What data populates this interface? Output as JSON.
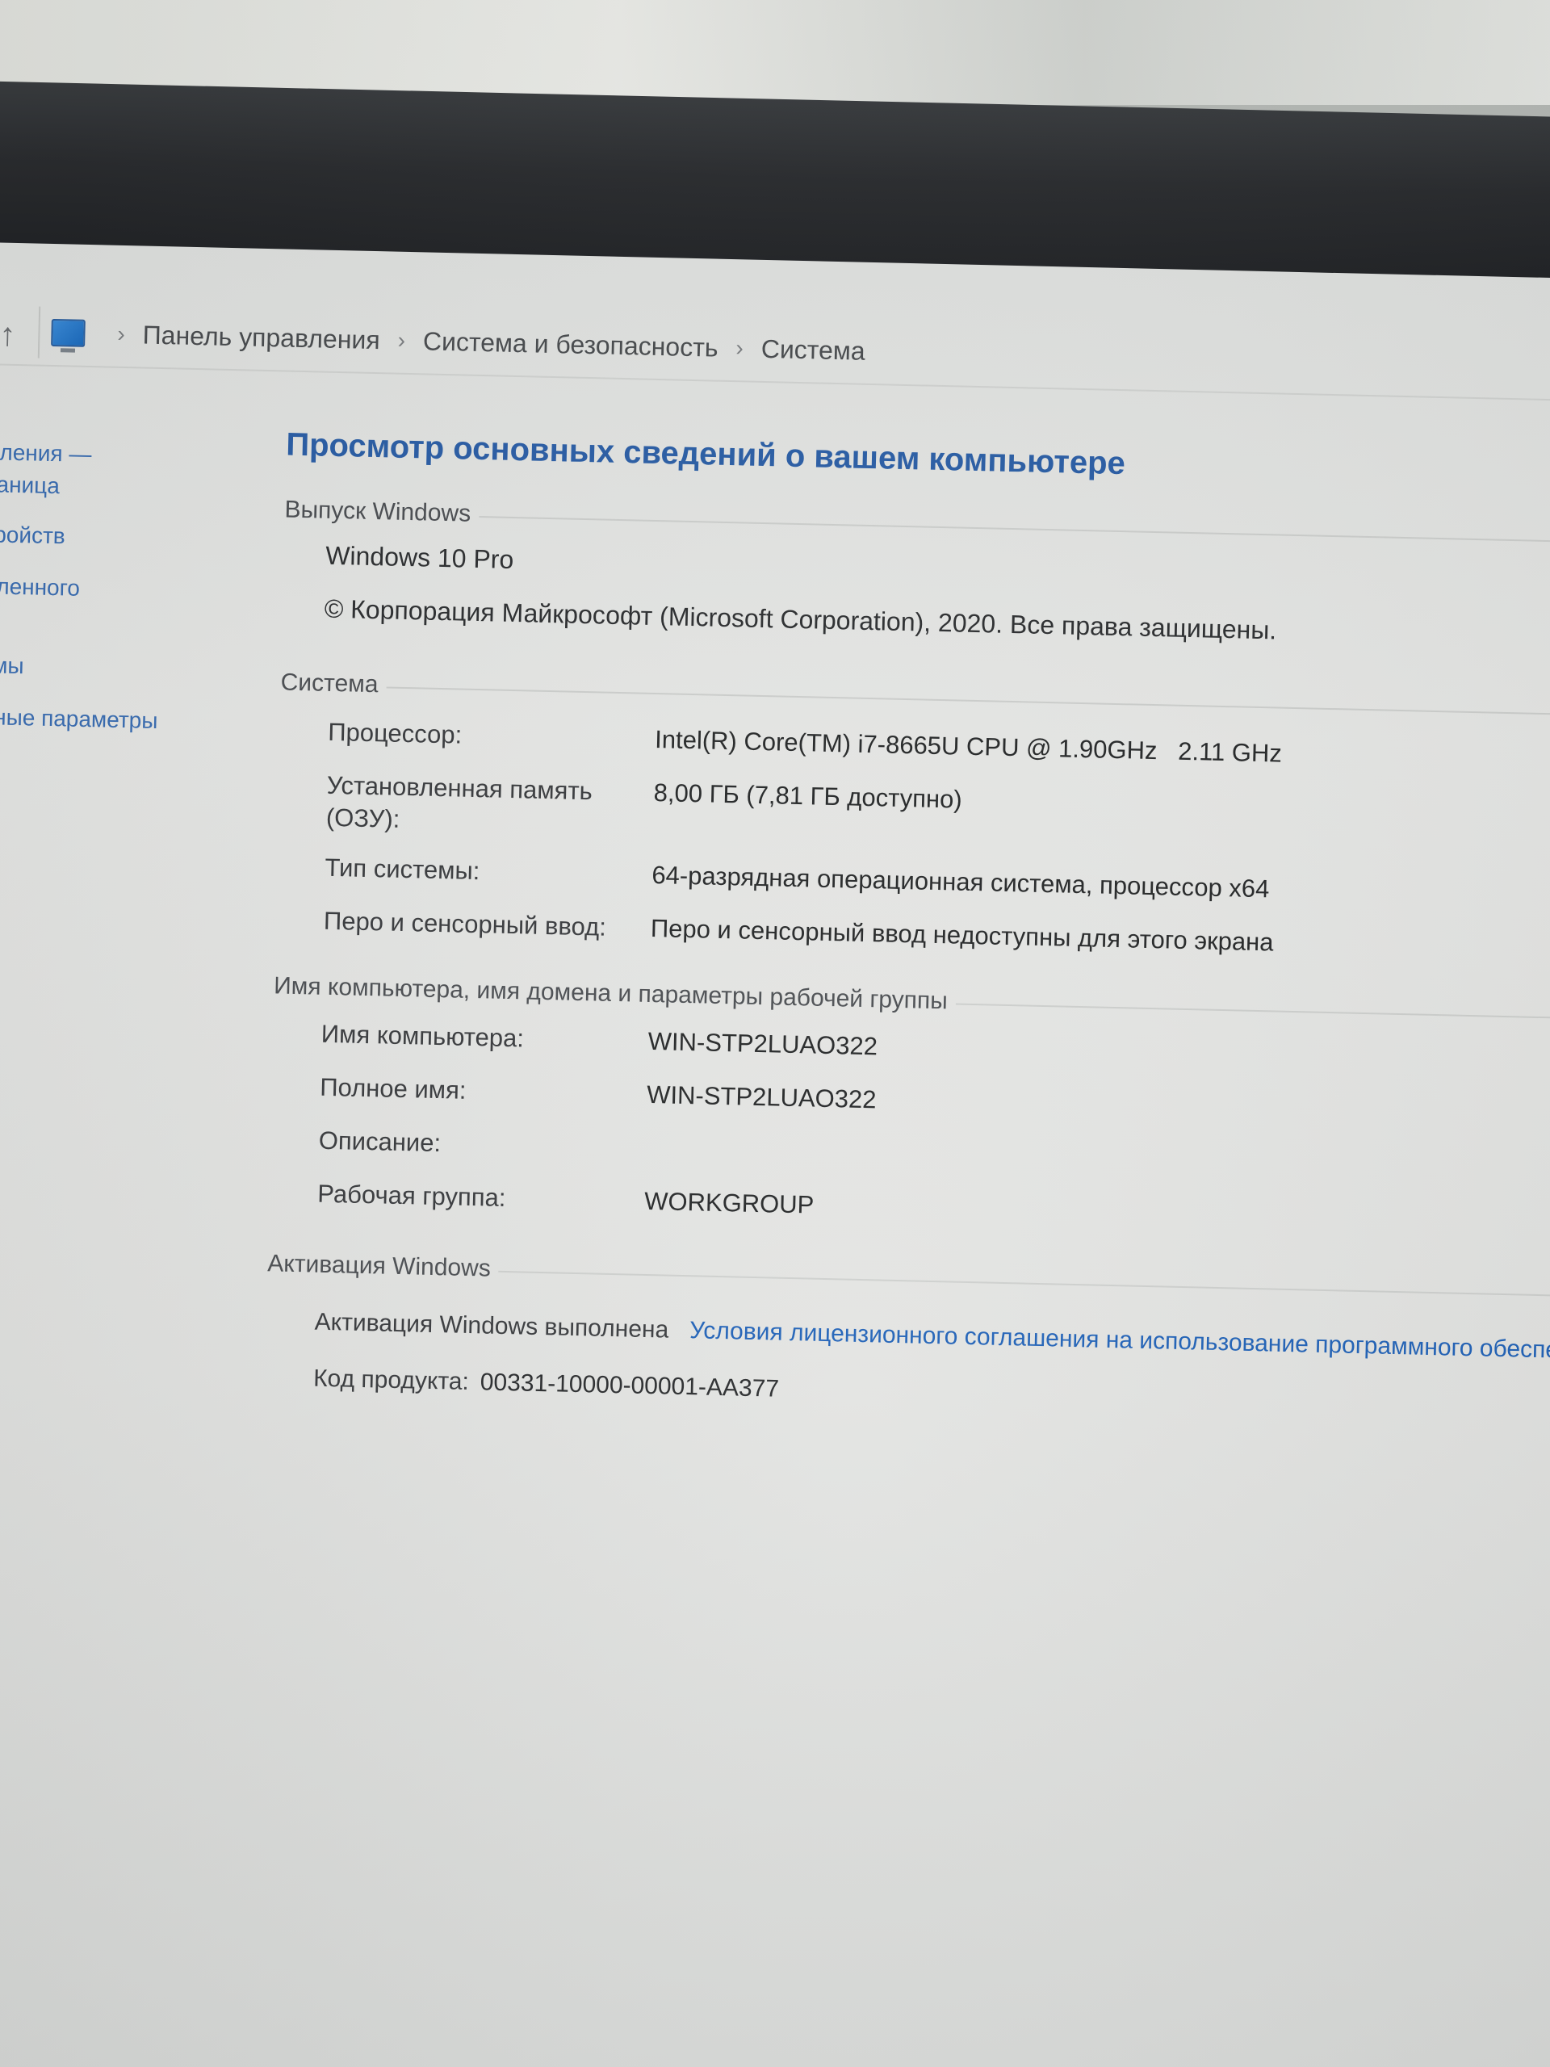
{
  "breadcrumb": {
    "items": [
      "Панель управления",
      "Система и безопасность",
      "Система"
    ],
    "separator": "›"
  },
  "sidebar": {
    "items": [
      "равления —",
      "страница",
      "устройств",
      "удаленного",
      "стемы",
      "ельные параметры"
    ]
  },
  "page_title": "Просмотр основных сведений о вашем компьютере",
  "edition": {
    "header": "Выпуск Windows",
    "name": "Windows 10 Pro",
    "copyright": "© Корпорация Майкрософт (Microsoft Corporation), 2020. Все права защищены."
  },
  "system": {
    "header": "Система",
    "rows": [
      {
        "label": "Процессор:",
        "value": "Intel(R) Core(TM) i7-8665U CPU @ 1.90GHz   2.11 GHz"
      },
      {
        "label": "Установленная память (ОЗУ):",
        "value": "8,00 ГБ (7,81 ГБ доступно)"
      },
      {
        "label": "Тип системы:",
        "value": "64-разрядная операционная система, процессор x64"
      },
      {
        "label": "Перо и сенсорный ввод:",
        "value": "Перо и сенсорный ввод недоступны для этого экрана"
      }
    ]
  },
  "computer_name": {
    "header": "Имя компьютера, имя домена и параметры рабочей группы",
    "rows": [
      {
        "label": "Имя компьютера:",
        "value": "WIN-STP2LUAO322"
      },
      {
        "label": "Полное имя:",
        "value": "WIN-STP2LUAO322"
      },
      {
        "label": "Описание:",
        "value": ""
      },
      {
        "label": "Рабочая группа:",
        "value": "WORKGROUP"
      }
    ]
  },
  "activation": {
    "header": "Активация Windows",
    "status": "Активация Windows выполнена",
    "license_link": "Условия лицензионного соглашения на использование программного обеспечения",
    "product_key_label": "Код продукта:",
    "product_key_value": "00331-10000-00001-AA377"
  },
  "colors": {
    "title": "#2b5fa8",
    "link": "#2062b8",
    "screen_bg": "#e6e7e5",
    "bezel": "#2b2d30"
  },
  "icons": {
    "up": "up-arrow-icon",
    "control_panel": "computer-monitor-icon"
  }
}
